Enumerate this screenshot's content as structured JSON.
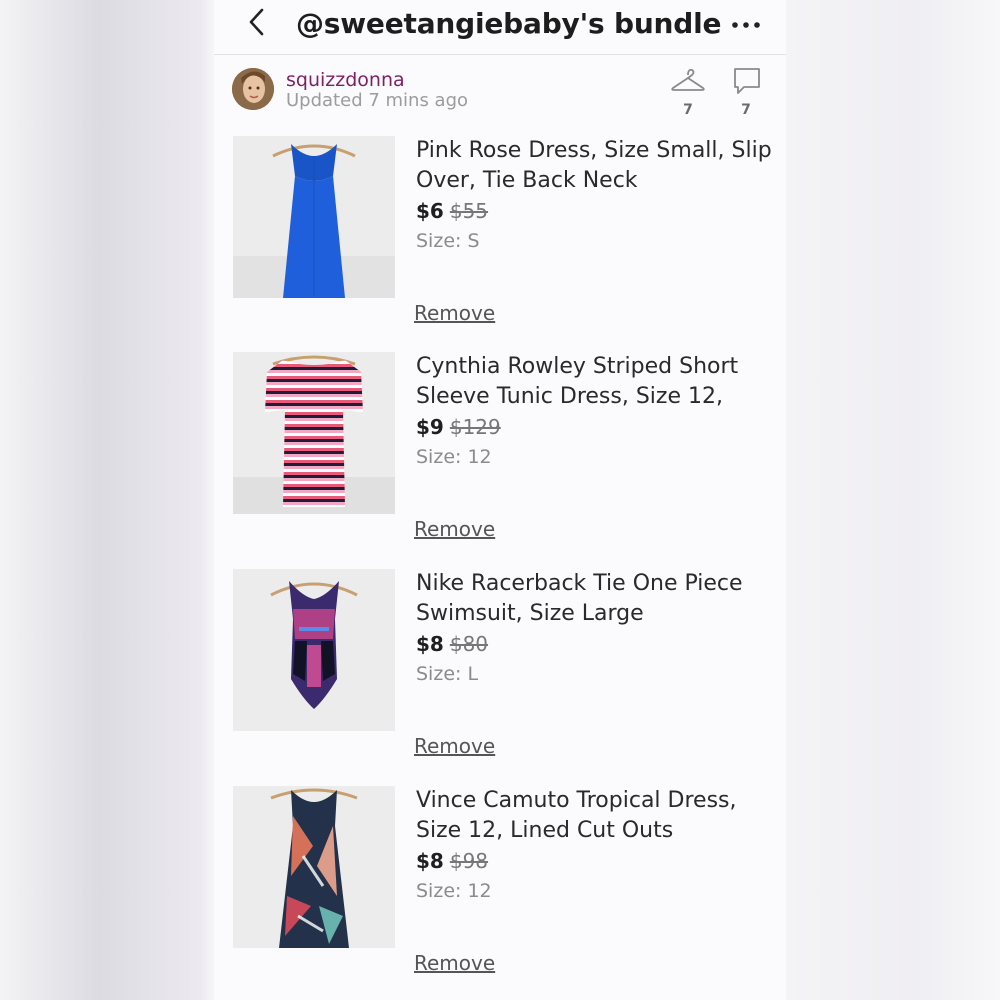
{
  "header": {
    "title": "@sweetangiebaby's bundle",
    "back_icon": "chevron-left-icon",
    "more_icon": "more-horizontal-icon"
  },
  "seller": {
    "username": "squizzdonna",
    "updated": "Updated 7 mins ago",
    "likes_count": "7",
    "comments_count": "7",
    "name_color": "#7d1f63"
  },
  "items": [
    {
      "title": "Pink Rose Dress, Size Small, Slip Over, Tie Back Neck",
      "price": "$6",
      "original_price": "$55",
      "size": "Size: S",
      "remove": "Remove"
    },
    {
      "title": "Cynthia Rowley Striped Short Sleeve Tunic Dress, Size 12,",
      "price": "$9",
      "original_price": "$129",
      "size": "Size: 12",
      "remove": "Remove"
    },
    {
      "title": "Nike Racerback Tie One Piece Swimsuit, Size Large",
      "price": "$8",
      "original_price": "$80",
      "size": "Size: L",
      "remove": "Remove"
    },
    {
      "title": "Vince Camuto Tropical Dress, Size 12, Lined Cut Outs",
      "price": "$8",
      "original_price": "$98",
      "size": "Size: 12",
      "remove": "Remove"
    }
  ]
}
